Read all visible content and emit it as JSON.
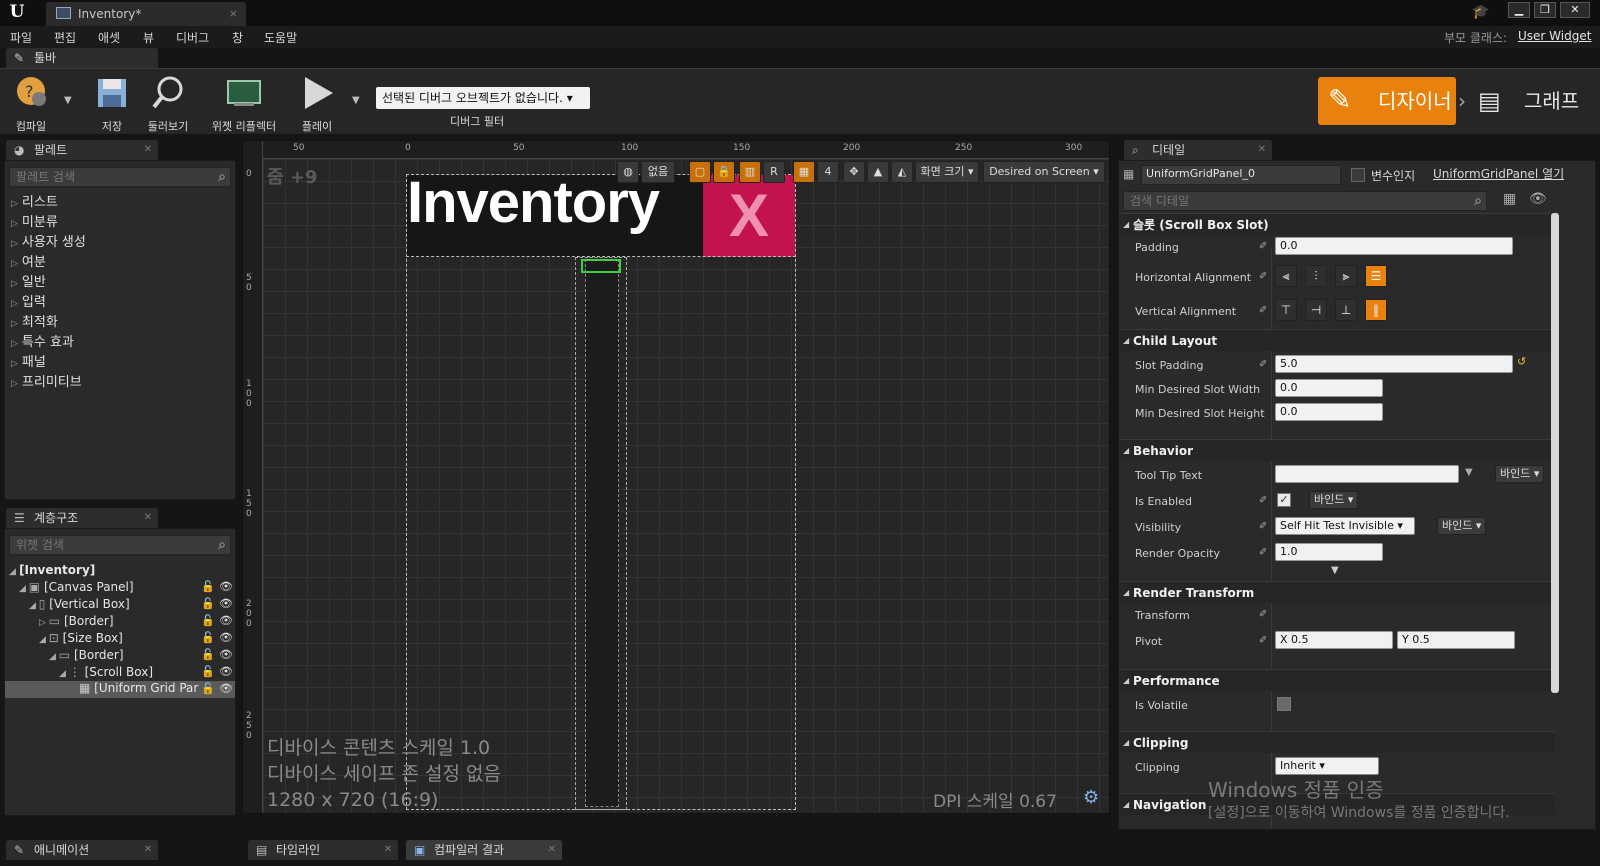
{
  "window": {
    "tab_title": "Inventory*",
    "minimize": "▁",
    "restore": "❐",
    "close": "✕"
  },
  "menu": {
    "items": [
      "파일",
      "편집",
      "애셋",
      "뷰",
      "디버그",
      "창",
      "도움말"
    ],
    "parent_class_label": "부모 클래스:",
    "parent_class_value": "User Widget"
  },
  "toolbar": {
    "tab_label": "툴바",
    "compile": "컴파일",
    "save": "저장",
    "browse": "둘러보기",
    "widget_reflector": "위젯 리플렉터",
    "play": "플레이",
    "debug_object": "선택된 디버그 오브젝트가 없습니다.",
    "debug_filter": "디버그 필터",
    "designer": "디자이너",
    "graph": "그래프"
  },
  "palette": {
    "tab_label": "팔레트",
    "search_placeholder": "팔레트 검색",
    "categories": [
      "리스트",
      "미분류",
      "사용자 생성",
      "여분",
      "일반",
      "입력",
      "최적화",
      "특수 효과",
      "패널",
      "프리미티브"
    ]
  },
  "hierarchy": {
    "tab_label": "계층구조",
    "search_placeholder": "위젯 검색",
    "items": [
      {
        "label": "[Inventory]",
        "depth": 0
      },
      {
        "label": "[Canvas Panel]",
        "depth": 1
      },
      {
        "label": "[Vertical Box]",
        "depth": 2
      },
      {
        "label": "[Border]",
        "depth": 3
      },
      {
        "label": "[Size Box]",
        "depth": 3
      },
      {
        "label": "[Border]",
        "depth": 4
      },
      {
        "label": "[Scroll Box]",
        "depth": 5
      },
      {
        "label": "[Uniform Grid Par",
        "depth": 6
      }
    ]
  },
  "viewport": {
    "zoom": "줌 +9",
    "ruler_top": [
      "50",
      "0",
      "50",
      "100",
      "150",
      "200",
      "250",
      "300"
    ],
    "ruler_left": [
      "0",
      "50",
      "100",
      "150",
      "200",
      "250"
    ],
    "toolbar": {
      "none_label": "없음",
      "r_label": "R",
      "grid_snap": "4",
      "screen_size": "화면 크기",
      "fill_mode": "Desired on Screen"
    },
    "widget_title": "Inventory",
    "close_label": "X",
    "device_scale": "디바이스 콘텐츠 스케일 1.0",
    "safe_zone": "디바이스 세이프 존 설정 없음",
    "resolution": "1280 x 720 (16:9)",
    "dpi_scale": "DPI 스케일 0.67"
  },
  "details": {
    "tab_label": "디테일",
    "widget_name": "UniformGridPanel_0",
    "is_variable_label": "변수인지",
    "open_class": "UniformGridPanel 열기",
    "search_placeholder": "검색 디테일",
    "sections": {
      "slot": "슬롯 (Scroll Box Slot)",
      "child_layout": "Child Layout",
      "behavior": "Behavior",
      "render_transform": "Render Transform",
      "performance": "Performance",
      "clipping": "Clipping",
      "navigation": "Navigation"
    },
    "props": {
      "padding": {
        "label": "Padding",
        "value": "0.0"
      },
      "h_align": {
        "label": "Horizontal Alignment"
      },
      "v_align": {
        "label": "Vertical Alignment"
      },
      "slot_padding": {
        "label": "Slot Padding",
        "value": "5.0"
      },
      "min_w": {
        "label": "Min Desired Slot Width",
        "value": "0.0"
      },
      "min_h": {
        "label": "Min Desired Slot Height",
        "value": "0.0"
      },
      "tooltip": {
        "label": "Tool Tip Text",
        "value": ""
      },
      "is_enabled": {
        "label": "Is Enabled"
      },
      "visibility": {
        "label": "Visibility",
        "value": "Self Hit Test Invisible"
      },
      "render_opacity": {
        "label": "Render Opacity",
        "value": "1.0"
      },
      "transform": {
        "label": "Transform"
      },
      "pivot": {
        "label": "Pivot",
        "x": "X  0.5",
        "y": "Y  0.5"
      },
      "is_volatile": {
        "label": "Is Volatile"
      },
      "clipping": {
        "label": "Clipping",
        "value": "Inherit"
      }
    },
    "bind_label": "바인드"
  },
  "bottom_tabs": {
    "animation": "애니메이션",
    "timeline": "타임라인",
    "compiler_results": "컴파일러 결과"
  },
  "watermark": {
    "line1": "Windows 정품 인증",
    "line2": "[설정]으로 이동하여 Windows를 정품 인증합니다."
  },
  "colors": {
    "accent": "#e8820c",
    "close_button": "#c2134f",
    "selection": "#3fcf3f"
  }
}
